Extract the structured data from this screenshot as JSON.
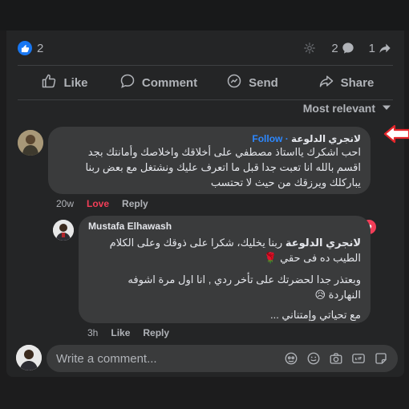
{
  "reactions": {
    "like_count": "2",
    "comment_count": "2",
    "share_count": "1"
  },
  "actions": {
    "like": "Like",
    "comment": "Comment",
    "send": "Send",
    "share": "Share"
  },
  "sort": {
    "label": "Most relevant"
  },
  "comment1": {
    "author": "لانجري الدلوعة",
    "follow": "· Follow",
    "lines": [
      "احب اشكرك يااستاذ مصطفي على أخلاقك واخلاصك وأمانتك بجد",
      "اقسم بالله انا تعبت جدا قبل ما اتعرف عليك ونشتغل مع بعض ربنا",
      "يباركلك ويرزقك من حيث لا تحتسب"
    ],
    "time": "20w",
    "love": "Love",
    "reply": "Reply"
  },
  "reply1": {
    "author": "Mustafa Elhawash",
    "mention": "لانجري الدلوعة",
    "line1_rest": " ربنا يخليك، شكرا على ذوقك وعلى الكلام",
    "line2": "الطيب ده فى حقي 🌹",
    "line3": "وبعتذر جدا لحضرتك على تأخر ردي , انا اول مرة اشوفه",
    "line4": "النهاردة 😥",
    "line5": "مع تحياتي وإمتناني ...",
    "time": "3h",
    "like": "Like",
    "reply": "Reply"
  },
  "composer": {
    "placeholder": "Write a comment..."
  },
  "colors": {
    "accent": "#2d88ff",
    "love": "#f33e58",
    "arrow": "#e4262b"
  }
}
